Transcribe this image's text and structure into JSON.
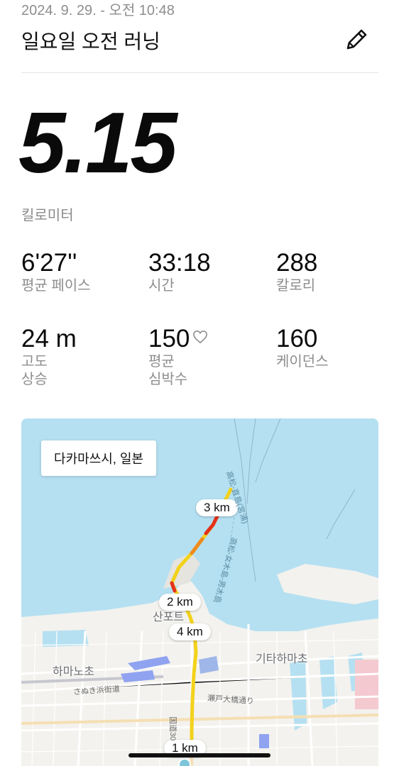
{
  "header": {
    "datetime": "2024. 9. 29. - 오전 10:48",
    "title": "일요일 오전 러닝"
  },
  "summary": {
    "distance": "5.15",
    "distance_unit": "킬로미터"
  },
  "stats": {
    "pace": {
      "value": "6'27''",
      "label": "평균 페이스"
    },
    "time": {
      "value": "33:18",
      "label": "시간"
    },
    "calories": {
      "value": "288",
      "label": "칼로리"
    },
    "elevation": {
      "value": "24 m",
      "label_1": "고도",
      "label_2": "상승"
    },
    "heart_rate": {
      "value": "150",
      "label_1": "평균",
      "label_2": "심박수"
    },
    "cadence": {
      "value": "160",
      "label": "케이던스"
    }
  },
  "map": {
    "location_label": "다카마쓰시, 일본",
    "km_markers": {
      "km3": "3 km",
      "km2": "2 km",
      "km4": "4 km",
      "km1": "1 km"
    },
    "places": {
      "sunport": "산포트",
      "kitahamacho": "기타하마초",
      "hamanocho": "하마노초"
    },
    "roads": {
      "sanuki_hama": "さぬき浜街道",
      "setoohashi": "瀬戸大橋通り",
      "route30": "国道30"
    },
    "sea_routes": {
      "takamatsu_ferry": "高松-直島(宮浦)",
      "megijima": "高松-女木島-男木島"
    },
    "colors": {
      "water": "#b5e0f1",
      "land": "#f3f2ee",
      "route_fast": "#f2d21b",
      "route_slow": "#e3321c"
    }
  },
  "icons": {
    "edit": "pencil-icon",
    "heart": "heart-outline-icon"
  }
}
